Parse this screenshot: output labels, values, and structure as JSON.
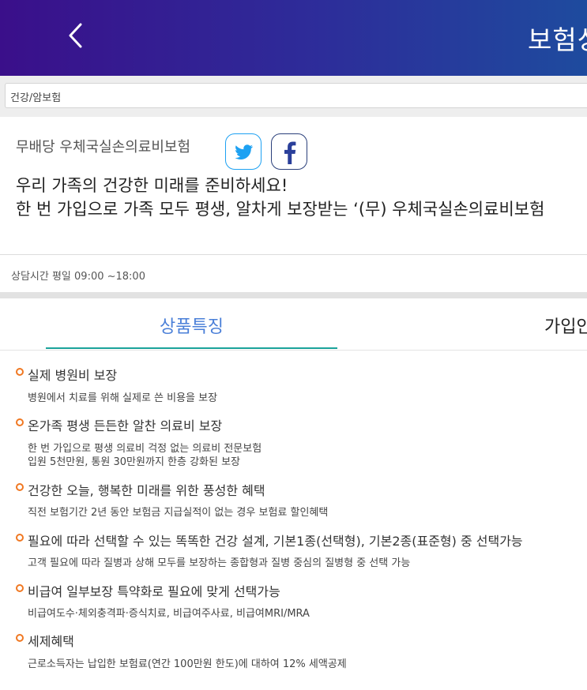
{
  "header": {
    "title": "보험상"
  },
  "breadcrumb": {
    "category": "건강/암보험"
  },
  "product": {
    "name": "무배당 우체국실손의료비보험",
    "headline1": "우리 가족의 건강한 미래를 준비하세요!",
    "headline2": "한 번 가입으로 가족 모두 평생, 알차게 보장받는 ‘(무) 우체국실손의료비보험"
  },
  "consult": {
    "hours": "상담시간 평일 09:00 ~18:00"
  },
  "tabs": {
    "features": "상품특징",
    "join": "가입안내"
  },
  "colors": {
    "accent": "#f07822",
    "tab_active": "#4a7fd8",
    "tab_underline": "#1aa39a"
  },
  "features": [
    {
      "title": "실제 병원비 보장",
      "desc1": "병원에서 치료를 위해 실제로 쓴 비용을 보장",
      "desc2": ""
    },
    {
      "title": "온가족 평생 든든한 알찬 의료비 보장",
      "desc1": "한 번 가입으로 평생 의료비 걱정 없는 의료비 전문보험",
      "desc2": "입원 5천만원, 통원 30만원까지 한층 강화된 보장"
    },
    {
      "title": "건강한 오늘, 행복한 미래를 위한 풍성한 혜택",
      "desc1": "직전 보험기간 2년 동안 보험금 지급실적이 없는 경우 보험료 할인혜택",
      "desc2": ""
    },
    {
      "title": "필요에 따라 선택할 수 있는 똑똑한 건강 설계, 기본1종(선택형), 기본2종(표준형) 중 선택가능",
      "desc1": "고객 필요에 따라 질병과 상해 모두를 보장하는 종합형과 질병 중심의 질병형 중 선택 가능",
      "desc2": ""
    },
    {
      "title": "비급여 일부보장 특약화로 필요에 맞게 선택가능",
      "desc1": "비급여도수·체외충격파·증식치료, 비급여주사료, 비급여MRI/MRA",
      "desc2": ""
    },
    {
      "title": "세제혜택",
      "desc1": "근로소득자는 납입한 보험료(연간 100만원 한도)에 대하여 12% 세액공제",
      "desc2": ""
    }
  ]
}
